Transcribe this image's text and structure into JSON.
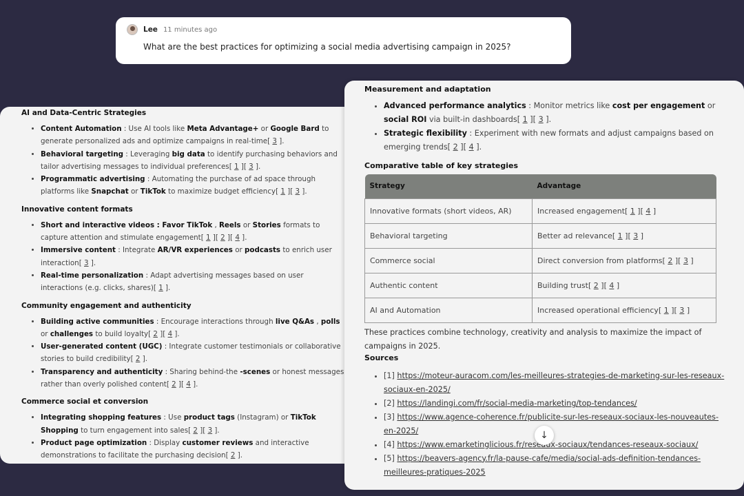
{
  "question": {
    "user": "Lee",
    "time": "11 minutes ago",
    "text": "What are the best practices for optimizing a social media advertising campaign in 2025?"
  },
  "left_sections": [
    {
      "title": "AI and Data-Centric Strategies",
      "items": [
        [
          {
            "b": true,
            "t": "Content Automation"
          },
          {
            "t": " : Use AI tools like "
          },
          {
            "b": true,
            "t": "Meta Advantage+"
          },
          {
            "t": " or "
          },
          {
            "b": true,
            "t": "Google Bard"
          },
          {
            "t": " to generate personalized ads and optimize campaigns in real-time"
          },
          {
            "c": [
              "3"
            ]
          },
          {
            "t": "."
          }
        ],
        [
          {
            "b": true,
            "t": "Behavioral targeting"
          },
          {
            "t": " : Leveraging "
          },
          {
            "b": true,
            "t": "big data"
          },
          {
            "t": " to identify purchasing behaviors and tailor advertising messages to individual preferences"
          },
          {
            "c": [
              "1",
              "3"
            ]
          },
          {
            "t": "."
          }
        ],
        [
          {
            "b": true,
            "t": "Programmatic advertising"
          },
          {
            "t": " : Automating the purchase of ad space through platforms like "
          },
          {
            "b": true,
            "t": "Snapchat"
          },
          {
            "t": " or "
          },
          {
            "b": true,
            "t": "TikTok"
          },
          {
            "t": " to maximize budget efficiency"
          },
          {
            "c": [
              "1",
              "3"
            ]
          },
          {
            "t": "."
          }
        ]
      ]
    },
    {
      "title": "Innovative content formats",
      "items": [
        [
          {
            "b": true,
            "t": "Short and interactive videos : Favor TikTok"
          },
          {
            "t": " , "
          },
          {
            "b": true,
            "t": "Reels"
          },
          {
            "t": " or "
          },
          {
            "b": true,
            "t": "Stories"
          },
          {
            "t": " formats to capture attention and stimulate engagement"
          },
          {
            "c": [
              "1",
              "2",
              "4"
            ]
          },
          {
            "t": "."
          }
        ],
        [
          {
            "b": true,
            "t": "Immersive content"
          },
          {
            "t": " : Integrate "
          },
          {
            "b": true,
            "t": "AR/VR experiences"
          },
          {
            "t": " or "
          },
          {
            "b": true,
            "t": "podcasts"
          },
          {
            "t": " to enrich user interaction"
          },
          {
            "c": [
              "3"
            ]
          },
          {
            "t": "."
          }
        ],
        [
          {
            "b": true,
            "t": "Real-time personalization"
          },
          {
            "t": " : Adapt advertising messages based on user interactions (e.g. clicks, shares)"
          },
          {
            "c": [
              "1"
            ]
          },
          {
            "t": "."
          }
        ]
      ]
    },
    {
      "title": "Community engagement and authenticity",
      "items": [
        [
          {
            "b": true,
            "t": "Building active communities"
          },
          {
            "t": " : Encourage interactions through "
          },
          {
            "b": true,
            "t": "live Q&As"
          },
          {
            "t": " , "
          },
          {
            "b": true,
            "t": "polls"
          },
          {
            "t": " or "
          },
          {
            "b": true,
            "t": "challenges"
          },
          {
            "t": " to build loyalty"
          },
          {
            "c": [
              "2",
              "4"
            ]
          },
          {
            "t": "."
          }
        ],
        [
          {
            "b": true,
            "t": "User-generated content (UGC)"
          },
          {
            "t": " : Integrate customer testimonials or collaborative stories to build credibility"
          },
          {
            "c": [
              "2"
            ]
          },
          {
            "t": "."
          }
        ],
        [
          {
            "b": true,
            "t": "Transparency and authenticity"
          },
          {
            "t": " : Sharing behind-the "
          },
          {
            "b": true,
            "t": "-scenes"
          },
          {
            "t": " or honest messages rather than overly polished content"
          },
          {
            "c": [
              "2",
              "4"
            ]
          },
          {
            "t": "."
          }
        ]
      ]
    },
    {
      "title": "Commerce social et conversion",
      "items": [
        [
          {
            "b": true,
            "t": "Integrating shopping features"
          },
          {
            "t": " : Use "
          },
          {
            "b": true,
            "t": "product tags"
          },
          {
            "t": " (Instagram) or "
          },
          {
            "b": true,
            "t": "TikTok Shopping"
          },
          {
            "t": " to turn engagement into sales"
          },
          {
            "c": [
              "2",
              "3"
            ]
          },
          {
            "t": "."
          }
        ],
        [
          {
            "b": true,
            "t": "Product page optimization"
          },
          {
            "t": " : Display "
          },
          {
            "b": true,
            "t": "customer reviews"
          },
          {
            "t": " and interactive demonstrations to facilitate the purchasing decision"
          },
          {
            "c": [
              "2"
            ]
          },
          {
            "t": "."
          }
        ]
      ]
    }
  ],
  "right_section": {
    "title": "Measurement and adaptation",
    "items": [
      [
        {
          "b": true,
          "t": "Advanced performance analytics"
        },
        {
          "t": " : Monitor metrics like "
        },
        {
          "b": true,
          "t": "cost per engagement"
        },
        {
          "t": " or "
        },
        {
          "b": true,
          "t": "social ROI"
        },
        {
          "t": " via built-in dashboards"
        },
        {
          "c": [
            "1",
            "3"
          ]
        },
        {
          "t": "."
        }
      ],
      [
        {
          "b": true,
          "t": "Strategic flexibility"
        },
        {
          "t": " : Experiment with new formats and adjust campaigns based on emerging trends"
        },
        {
          "c": [
            "2",
            "4"
          ]
        },
        {
          "t": "."
        }
      ]
    ]
  },
  "table": {
    "title": "Comparative table of key strategies",
    "headers": [
      "Strategy",
      "Advantage"
    ],
    "rows": [
      {
        "strategy": "Innovative formats (short videos, AR)",
        "advantage": "Increased engagement",
        "cites": [
          "1",
          "4"
        ]
      },
      {
        "strategy": "Behavioral targeting",
        "advantage": "Better ad relevance",
        "cites": [
          "1",
          "3"
        ]
      },
      {
        "strategy": "Commerce social",
        "advantage": "Direct conversion from platforms",
        "cites": [
          "2",
          "3"
        ]
      },
      {
        "strategy": "Authentic content",
        "advantage": "Building trust",
        "cites": [
          "2",
          "4"
        ]
      },
      {
        "strategy": "AI and Automation",
        "advantage": "Increased operational efficiency",
        "cites": [
          "1",
          "3"
        ]
      }
    ]
  },
  "conclusion": "These practices combine technology, creativity and analysis to maximize the impact of campaigns in 2025.",
  "sources": {
    "title": "Sources",
    "items": [
      {
        "num": "[1]",
        "url": "https://moteur-auracom.com/les-meilleures-strategies-de-marketing-sur-les-reseaux-sociaux-en-2025/"
      },
      {
        "num": "[2]",
        "url": "https://landingi.com/fr/social-media-marketing/top-tendances/"
      },
      {
        "num": "[3]",
        "url": "https://www.agence-coherence.fr/publicite-sur-les-reseaux-sociaux-les-nouveautes-en-2025/"
      },
      {
        "num": "[4]",
        "url": "https://www.emarketinglicious.fr/reseaux-sociaux/tendances-reseaux-sociaux/"
      },
      {
        "num": "[5]",
        "url": "https://beavers-agency.fr/la-pause-cafe/media/social-ads-definition-tendances-meilleures-pratiques-2025"
      }
    ]
  },
  "icons": {
    "scroll_down": "arrow-down-icon",
    "avatar": "user-avatar"
  }
}
